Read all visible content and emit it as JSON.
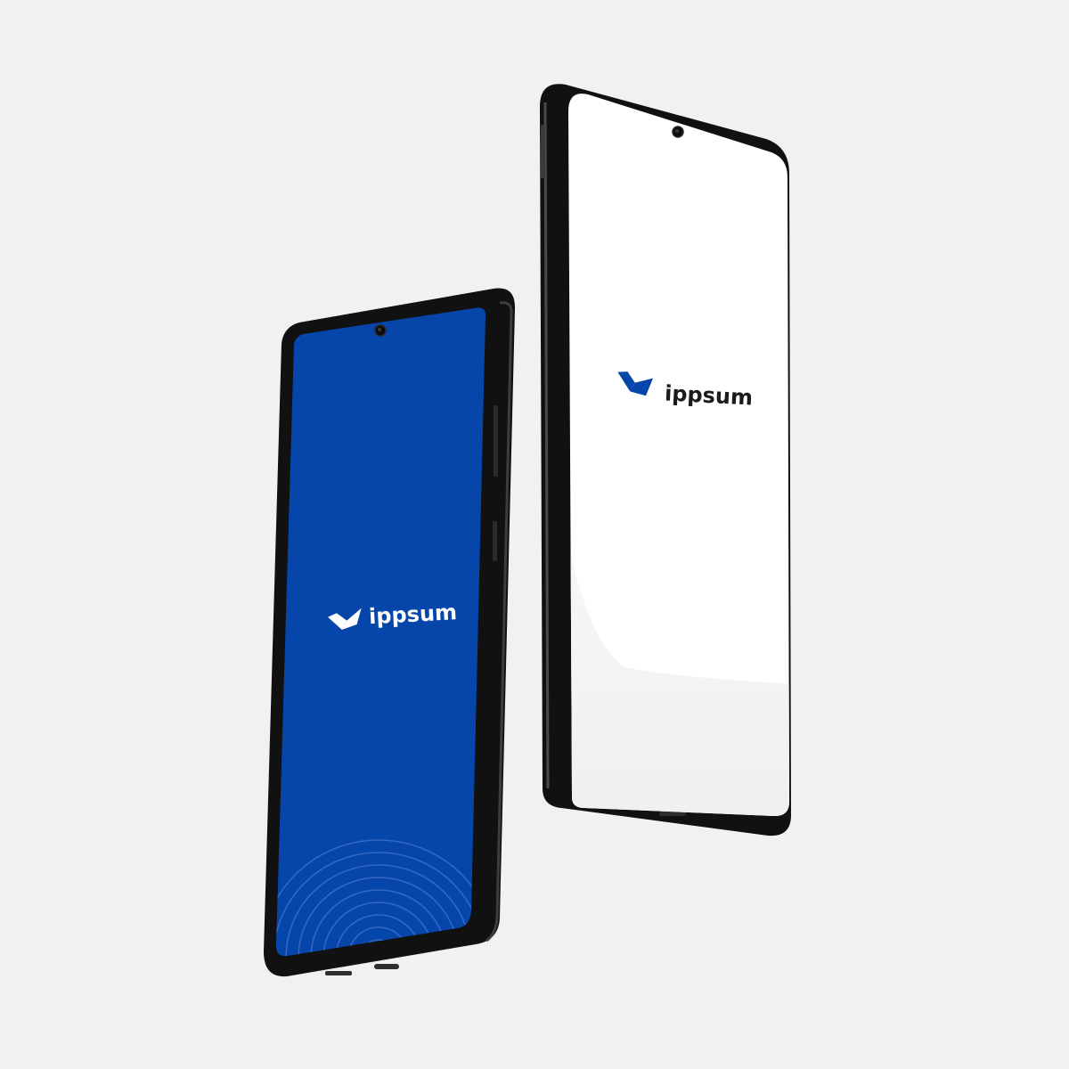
{
  "mockup": {
    "background_color": "#f1f1f1",
    "brand_blue": "#0645aa",
    "phone_left": {
      "screen_color": "#0645aa",
      "brand_text": "ippsum",
      "brand_text_color": "#ffffff",
      "logo_icon": "folded-chevron-logo-icon",
      "decoration": "concentric-arcs"
    },
    "phone_right": {
      "screen_color": "#ffffff",
      "brand_text": "ippsum",
      "brand_text_color": "#1b1b1b",
      "logo_icon": "folded-chevron-logo-icon"
    }
  }
}
